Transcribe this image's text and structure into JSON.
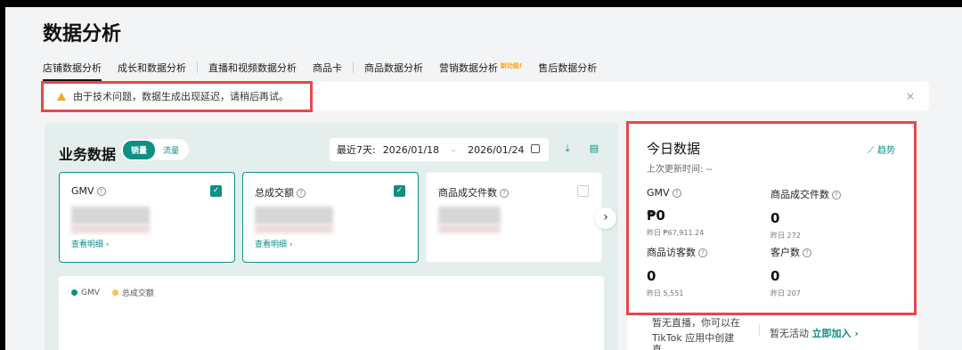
{
  "page": {
    "title": "数据分析"
  },
  "tabs": [
    {
      "label": "店铺数据分析"
    },
    {
      "label": "成长和数据分析"
    },
    {
      "label": "直播和视频数据分析"
    },
    {
      "label": "商品卡"
    },
    {
      "label": "商品数据分析"
    },
    {
      "label": "营销数据分析",
      "badge": "新功能!"
    },
    {
      "label": "售后数据分析"
    }
  ],
  "alert": {
    "text": "由于技术问题，数据生成出现延迟，请稍后再试。",
    "close": "×"
  },
  "business": {
    "title": "业务数据",
    "toggle": {
      "on": "销量",
      "off": "流量"
    },
    "date": {
      "label": "最近7天:",
      "start": "2026/01/18",
      "sep": "-",
      "end": "2026/01/24"
    },
    "metrics": [
      {
        "name": "GMV",
        "link": "查看明细 ›",
        "checked": true
      },
      {
        "name": "总成交额",
        "link": "查看明细 ›",
        "checked": true
      },
      {
        "name": "商品成交件数",
        "checked": false
      }
    ],
    "legend": [
      "GMV",
      "总成交额"
    ],
    "next": "›"
  },
  "today": {
    "title": "今日数据",
    "updated": "上次更新时间: --",
    "trend": "趋势",
    "stats": [
      {
        "name": "GMV",
        "value": "₱0",
        "prev": "昨日 ₱67,911.24"
      },
      {
        "name": "商品成交件数",
        "value": "0",
        "prev": "昨日 272"
      },
      {
        "name": "商品访客数",
        "value": "0",
        "prev": "昨日 5,551"
      },
      {
        "name": "客户数",
        "value": "0",
        "prev": "昨日 207"
      }
    ]
  },
  "bottom": {
    "left_line1": "暂无直播，你可以在",
    "left_line2": "TikTok 应用中创建直...",
    "right_text": "暂无活动",
    "right_link": "立即加入 ›"
  },
  "colors": {
    "accent": "#0e8f86",
    "highlight": "#e5484d",
    "warning": "#f5a623",
    "legend2": "#f2c94c"
  }
}
